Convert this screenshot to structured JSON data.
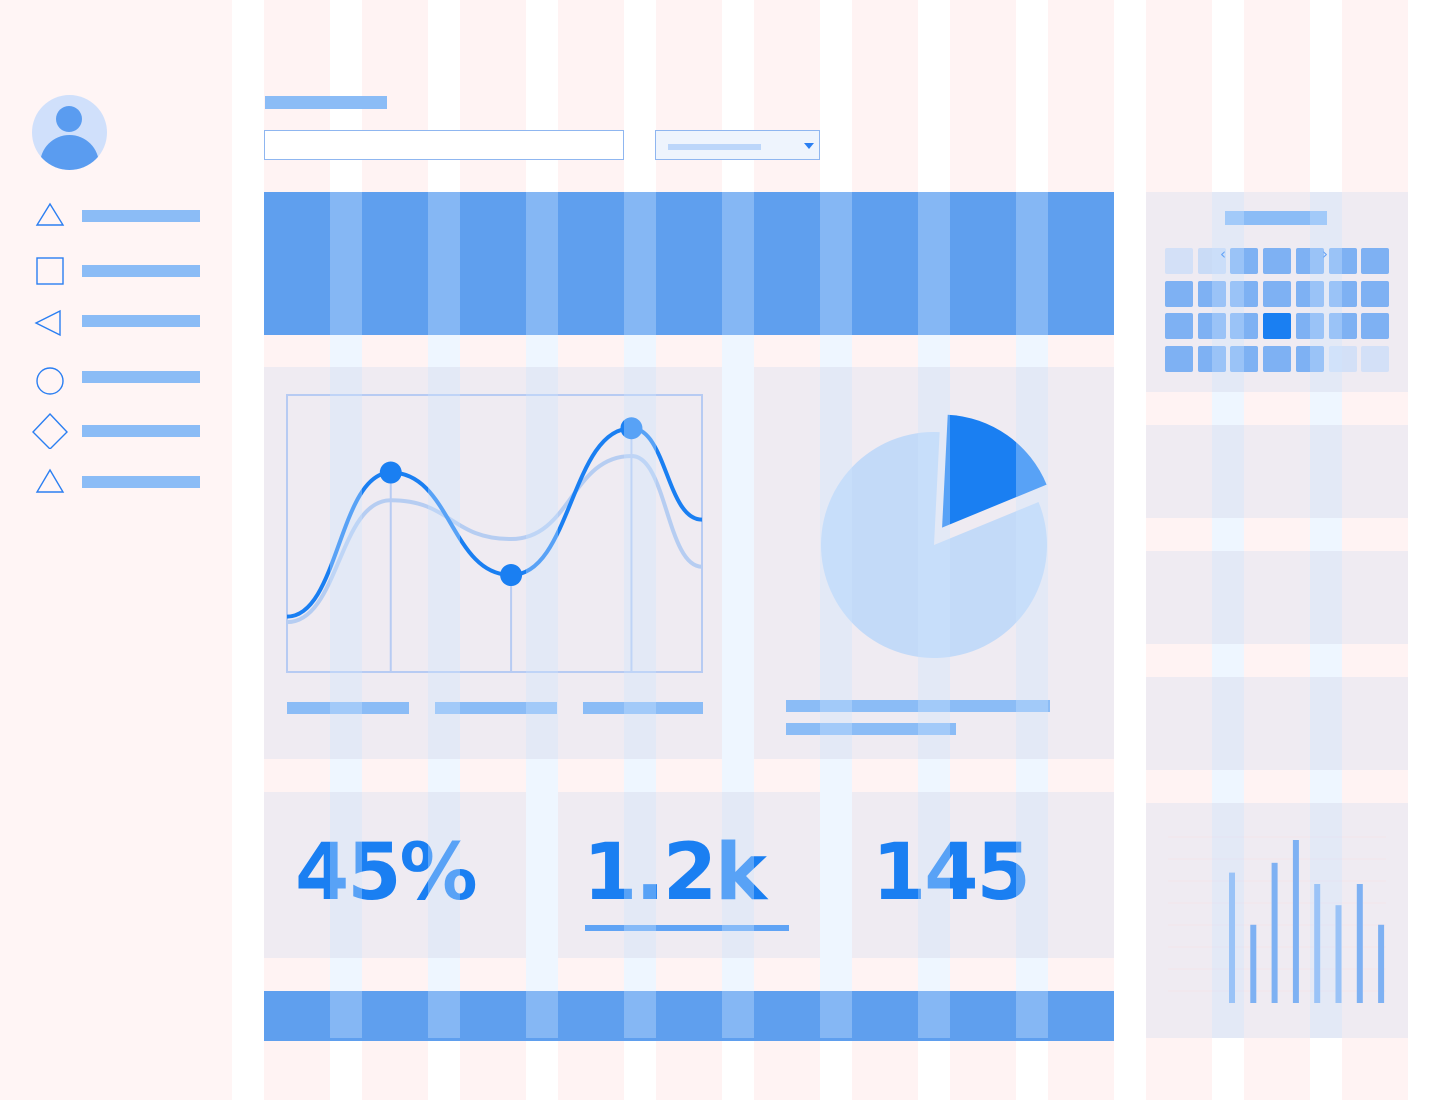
{
  "search": {
    "value": "",
    "placeholder": ""
  },
  "navigation": {
    "items": [
      {
        "icon": "triangle-icon"
      },
      {
        "icon": "square-icon"
      },
      {
        "icon": "left-triangle-icon"
      },
      {
        "icon": "circle-icon"
      },
      {
        "icon": "diamond-icon"
      },
      {
        "icon": "triangle-icon"
      }
    ]
  },
  "calendar": {
    "prev_icon": "‹",
    "next_icon": "›"
  },
  "kpis": [
    {
      "value": "45%"
    },
    {
      "value": "1.2k"
    },
    {
      "value": "145"
    }
  ],
  "chart_data": [
    {
      "type": "line",
      "series": [
        {
          "values": [
            0.2,
            0.72,
            0.35,
            0.88,
            0.55
          ]
        },
        {
          "values": [
            0.18,
            0.62,
            0.48,
            0.78,
            0.38
          ]
        }
      ]
    },
    {
      "type": "pie",
      "values": [
        18,
        82
      ]
    },
    {
      "type": "bar",
      "values": [
        0.8,
        0.48,
        0.86,
        1.0,
        0.73,
        0.6,
        0.73,
        0.48
      ]
    }
  ],
  "colors": {
    "accent": "#1a7ff2",
    "accent_soft": "#8bbcf6",
    "banner": "#5f9fee",
    "card": "#efebf2",
    "grid": "#fff3f3"
  }
}
